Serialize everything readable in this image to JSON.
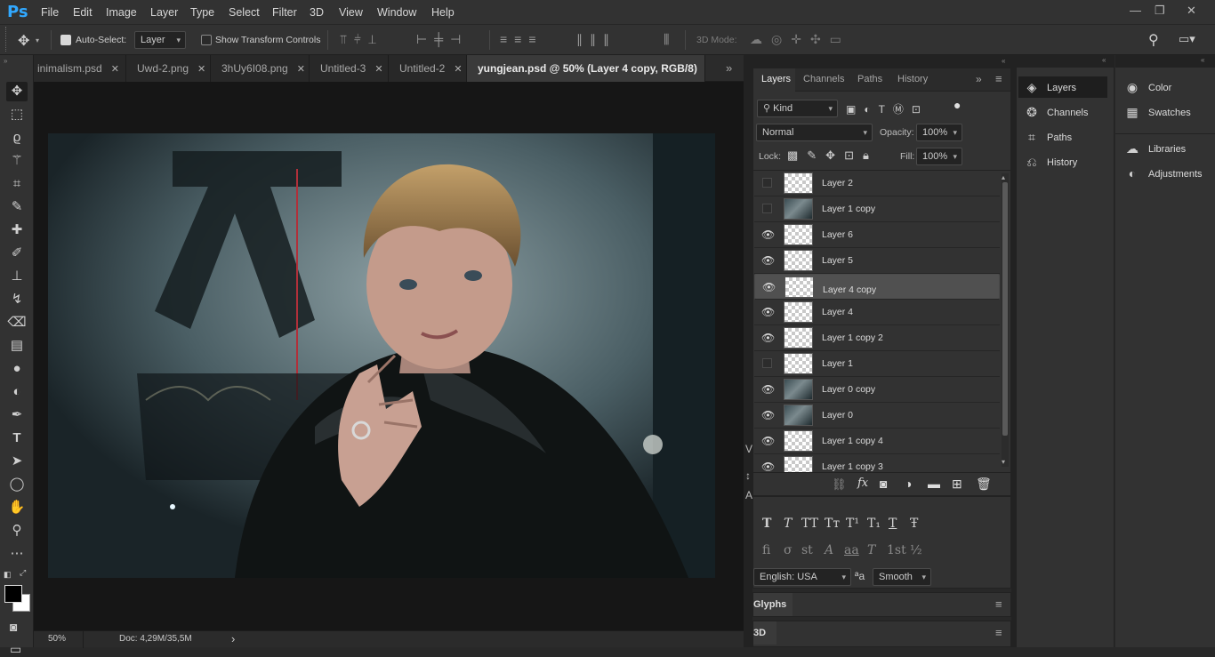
{
  "app": {
    "logo": "Ps"
  },
  "menu": [
    "File",
    "Edit",
    "Image",
    "Layer",
    "Type",
    "Select",
    "Filter",
    "3D",
    "View",
    "Window",
    "Help"
  ],
  "window_controls": {
    "minimize": "—",
    "restore": "❐",
    "close": "✕"
  },
  "options_bar": {
    "auto_select_label": "Auto-Select:",
    "auto_select_checked": true,
    "auto_select_value": "Layer",
    "show_transform_label": "Show Transform Controls",
    "show_transform_checked": false,
    "mode_3d_label": "3D Mode:"
  },
  "tabs": [
    {
      "label": "inimalism.psd",
      "close": "✕",
      "active": false
    },
    {
      "label": "Uwd-2.png",
      "close": "✕",
      "active": false
    },
    {
      "label": "3hUy6I08.png",
      "close": "✕",
      "active": false
    },
    {
      "label": "Untitled-3",
      "close": "✕",
      "active": false
    },
    {
      "label": "Untitled-2",
      "close": "✕",
      "active": false
    },
    {
      "label": "yungjean.psd @ 50% (Layer 4 copy, RGB/8) *",
      "close": "✕",
      "active": true
    }
  ],
  "tabs_overflow": "»",
  "status": {
    "zoom": "50%",
    "doc": "Doc: 4,29M/35,5M",
    "arrow": "›"
  },
  "layers_panel": {
    "tabs": [
      "Layers",
      "Channels",
      "Paths",
      "History"
    ],
    "active_tab": "Layers",
    "filter_kind": "Kind",
    "blend_mode": "Normal",
    "opacity_label": "Opacity:",
    "opacity_value": "100%",
    "lock_label": "Lock:",
    "fill_label": "Fill:",
    "fill_value": "100%",
    "layers": [
      {
        "name": "Layer 2",
        "visible": false,
        "selected": false,
        "thumb": "transparent"
      },
      {
        "name": "Layer 1 copy",
        "visible": false,
        "selected": false,
        "thumb": "image"
      },
      {
        "name": "Layer 6",
        "visible": true,
        "selected": false,
        "thumb": "transparent"
      },
      {
        "name": "Layer 5",
        "visible": true,
        "selected": false,
        "thumb": "transparent"
      },
      {
        "name": "Layer 4 copy",
        "visible": true,
        "selected": true,
        "thumb": "transparent"
      },
      {
        "name": "Layer 4",
        "visible": true,
        "selected": false,
        "thumb": "transparent"
      },
      {
        "name": "Layer 1 copy 2",
        "visible": true,
        "selected": false,
        "thumb": "transparent"
      },
      {
        "name": "Layer 1",
        "visible": false,
        "selected": false,
        "thumb": "transparent"
      },
      {
        "name": "Layer 0 copy",
        "visible": true,
        "selected": false,
        "thumb": "image"
      },
      {
        "name": "Layer 0",
        "visible": true,
        "selected": false,
        "thumb": "image"
      },
      {
        "name": "Layer 1 copy 4",
        "visible": true,
        "selected": false,
        "thumb": "transparent"
      },
      {
        "name": "Layer 1 copy 3",
        "visible": true,
        "selected": false,
        "thumb": "transparent"
      }
    ],
    "bottom_icons": [
      "link-icon",
      "fx-icon",
      "mask-icon",
      "adjustment-icon",
      "folder-icon",
      "new-layer-icon",
      "trash-icon"
    ],
    "fx_label": "fx"
  },
  "character_panel": {
    "row1": [
      "T",
      "T",
      "TT",
      "Tт",
      "T¹",
      "T₁",
      "T",
      "Ŧ"
    ],
    "row2": [
      "fi",
      "σ",
      "st",
      "A",
      "aa",
      "T",
      "1st",
      "½"
    ],
    "language": "English: USA",
    "aa_label": "ªa",
    "antialias": "Smooth"
  },
  "glyphs_panel": {
    "title": "Glyphs"
  },
  "panel_3d": {
    "title": "3D"
  },
  "side_col1": [
    "Layers",
    "Channels",
    "Paths",
    "History"
  ],
  "side_col2": [
    "Color",
    "Swatches",
    "Libraries",
    "Adjustments"
  ]
}
